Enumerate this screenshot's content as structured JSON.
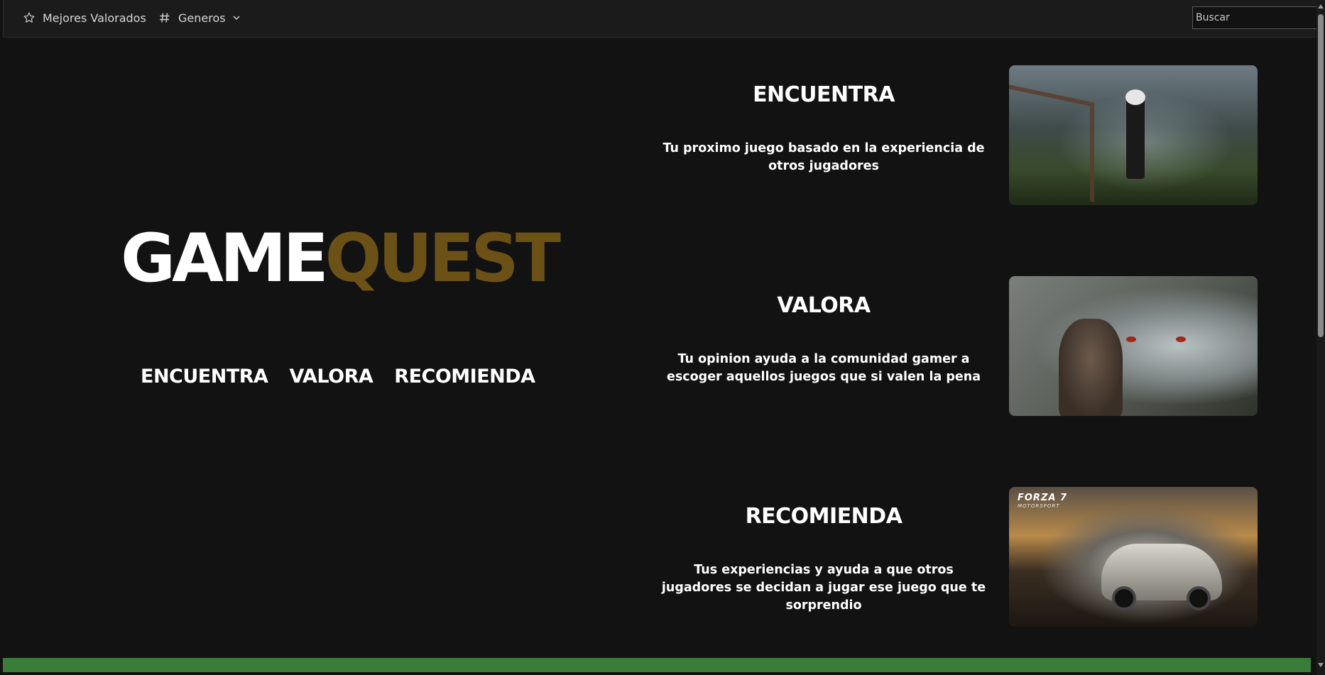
{
  "navbar": {
    "top_rated_label": "Mejores Valorados",
    "genres_label": "Generos",
    "search_placeholder": "Buscar"
  },
  "hero": {
    "logo_part1": "GAME",
    "logo_part2": "QUEST",
    "links": [
      "ENCUENTRA",
      "VALORA",
      "RECOMIENDA"
    ]
  },
  "features": [
    {
      "title": "ENCUENTRA",
      "text": "Tu proximo juego basado en la experiencia de otros jugadores"
    },
    {
      "title": "VALORA",
      "text": "Tu opinion ayuda a la comunidad gamer a escoger aquellos juegos que si valen la pena"
    },
    {
      "title": "RECOMIENDA",
      "text": "Tus experiencias y ayuda a que otros jugadores se decidan a jugar ese juego que te sorprendio"
    }
  ],
  "images": {
    "brand_text": "FORZA 7",
    "brand_sub": "MOTORSPORT"
  },
  "colors": {
    "background": "#121212",
    "logo_accent": "#6b5116",
    "footer_bar": "#3a7d38"
  },
  "icons": [
    "star-icon",
    "hash-icon",
    "chevron-down-icon"
  ]
}
